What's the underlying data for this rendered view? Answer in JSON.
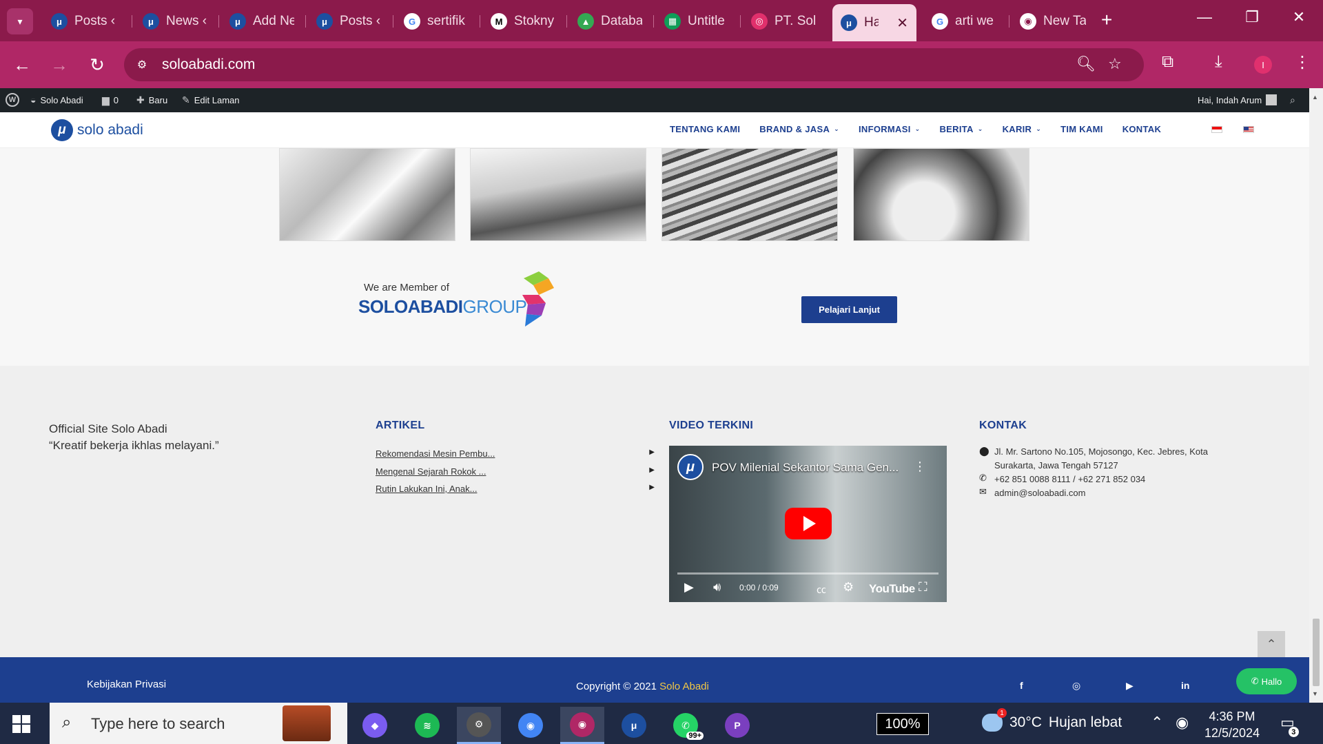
{
  "browser": {
    "tabs": [
      {
        "title": "Posts ‹",
        "icon": "soloabadi-icon",
        "color": "#1d4fa0"
      },
      {
        "title": "News ‹",
        "icon": "soloabadi-icon",
        "color": "#1d4fa0"
      },
      {
        "title": "Add Ne",
        "icon": "soloabadi-icon",
        "color": "#1d4fa0"
      },
      {
        "title": "Posts ‹",
        "icon": "soloabadi-icon",
        "color": "#1d4fa0"
      },
      {
        "title": "sertifik",
        "icon": "google-icon",
        "color": "#ffffff"
      },
      {
        "title": "Stokny",
        "icon": "mailchimp-icon",
        "color": "#ffffff"
      },
      {
        "title": "Databa",
        "icon": "google-drive-icon",
        "color": "#34a853"
      },
      {
        "title": "Untitle",
        "icon": "google-sheets-icon",
        "color": "#0f9d58"
      },
      {
        "title": "PT. Sol",
        "icon": "instagram-icon",
        "color": "#e1306c"
      },
      {
        "title": "Ha",
        "icon": "soloabadi-icon",
        "color": "#1d4fa0",
        "active": true
      },
      {
        "title": "arti we",
        "icon": "google-icon",
        "color": "#ffffff"
      },
      {
        "title": "New Ta",
        "icon": "chrome-icon",
        "color": "#ffffff"
      }
    ],
    "url": "soloabadi.com",
    "profile_initial": "I",
    "theme_color": "#8b1a4b"
  },
  "wpbar": {
    "site_name": "Solo Abadi",
    "comments": "0",
    "new_label": "Baru",
    "edit_label": "Edit Laman",
    "greeting": "Hai, Indah Arum"
  },
  "header": {
    "logo_text": "solo abadi",
    "nav": [
      {
        "label": "TENTANG KAMI",
        "has_caret": false
      },
      {
        "label": "BRAND & JASA",
        "has_caret": true
      },
      {
        "label": "INFORMASI",
        "has_caret": true
      },
      {
        "label": "BERITA",
        "has_caret": true
      },
      {
        "label": "KARIR",
        "has_caret": true
      },
      {
        "label": "TIM KAMI",
        "has_caret": false
      },
      {
        "label": "KONTAK",
        "has_caret": false
      }
    ]
  },
  "member": {
    "pre_text": "We are Member of",
    "brand_main": "SOLOABADI",
    "brand_group": "GROUP",
    "cta_label": "Pelajari Lanjut",
    "brand_color": "#1d3f8f"
  },
  "footer": {
    "about_line1": "Official Site Solo Abadi",
    "about_line2": "“Kreatif bekerja ikhlas melayani.”",
    "artikel_heading": "ARTIKEL",
    "articles": [
      "Rekomendasi Mesin Pembu...",
      "Mengenal Sejarah Rokok ...",
      "Rutin Lakukan Ini, Anak..."
    ],
    "video_heading": "VIDEO TERKINI",
    "video": {
      "title": "POV Milenial Sekantor Sama Gen...",
      "time": "0:00 / 0:09",
      "brand": "YouTube"
    },
    "kontak_heading": "KONTAK",
    "address_line1": "Jl. Mr. Sartono No.105, Mojosongo, Kec. Jebres, Kota",
    "address_line2": "Surakarta, Jawa Tengah 57127",
    "phone": "+62 851 0088 8111 / +62 271 852 034",
    "email": "admin@soloabadi.com",
    "privacy": "Kebijakan Privasi",
    "copyright_prefix": "Copyright © 2021 ",
    "copyright_brand": "Solo Abadi",
    "whatsapp_label": "Hallo",
    "social": [
      "facebook-icon",
      "instagram-icon",
      "youtube-icon",
      "linkedin-icon"
    ]
  },
  "taskbar": {
    "search_placeholder": "Type here to search",
    "apps": [
      {
        "name": "copilot-icon",
        "color": "#7a5cf0"
      },
      {
        "name": "spotify-icon",
        "color": "#1db954"
      },
      {
        "name": "settings-icon",
        "color": "#555555",
        "active": true
      },
      {
        "name": "chrome-icon",
        "color": "#4285f4"
      },
      {
        "name": "chrome-profile-icon",
        "color": "#b02766",
        "active": true
      },
      {
        "name": "chrome-profile-2-icon",
        "color": "#1d4fa0"
      },
      {
        "name": "whatsapp-icon",
        "color": "#25d366",
        "badge": "99+"
      },
      {
        "name": "pdf-icon",
        "color": "#7a3fbf"
      }
    ],
    "zoom": "100%",
    "temperature": "30°C",
    "weather": "Hujan lebat",
    "weather_alert": "1",
    "time": "4:36 PM",
    "date": "12/5/2024",
    "notifications": "3"
  }
}
